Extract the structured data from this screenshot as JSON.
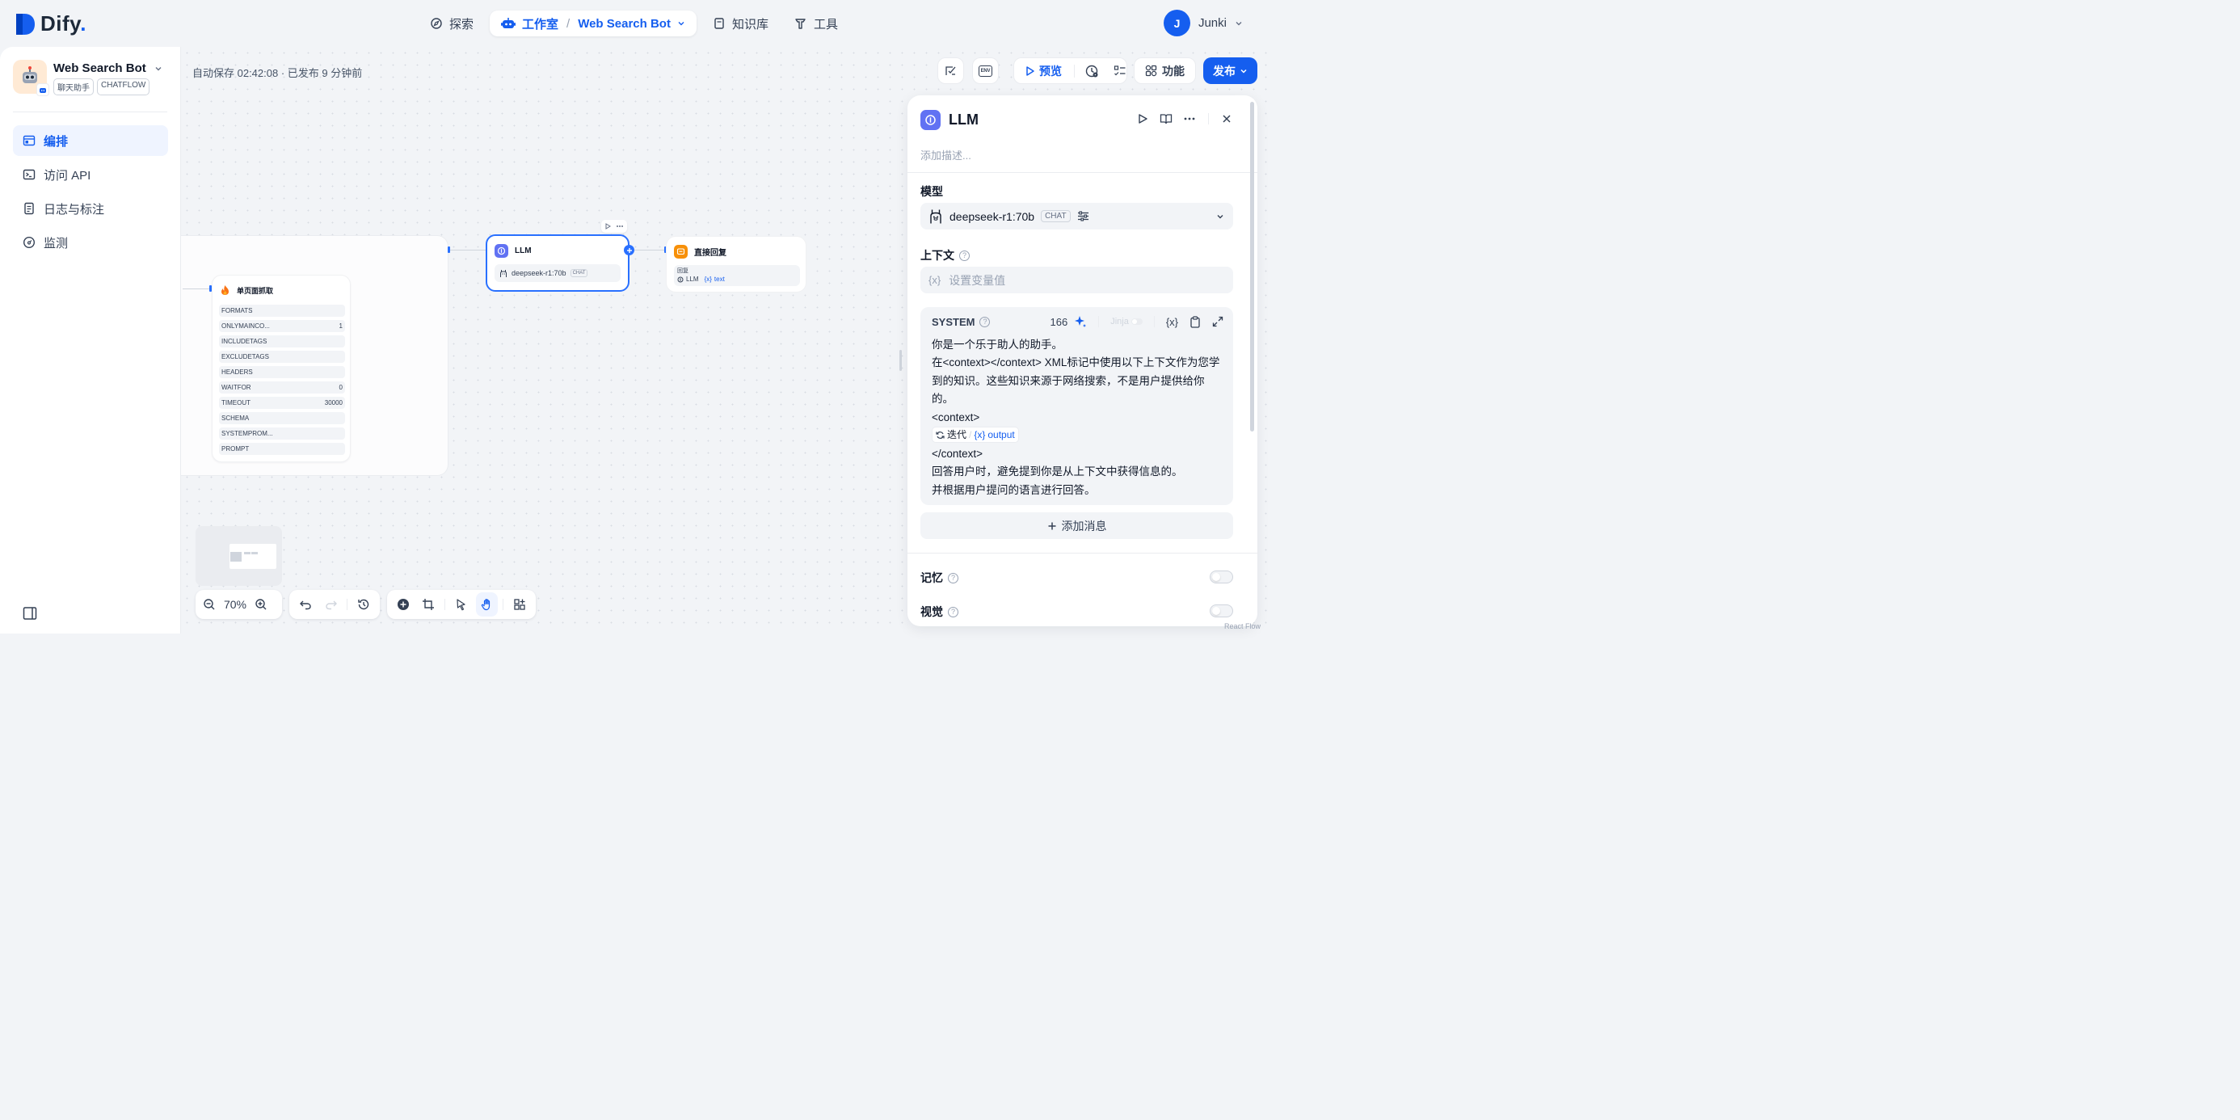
{
  "brand": {
    "logo_text": "Dify",
    "logo_suffix": "."
  },
  "nav": {
    "explore": "探索",
    "studio": "工作室",
    "separator": "/",
    "current_app": "Web Search Bot",
    "knowledge": "知识库",
    "tools": "工具"
  },
  "user": {
    "initial": "J",
    "name": "Junki"
  },
  "sidebar": {
    "app_name": "Web Search Bot",
    "app_tags": [
      "聊天助手",
      "CHATFLOW"
    ],
    "items": [
      {
        "label": "编排",
        "icon": "layout-icon",
        "active": true
      },
      {
        "label": "访问 API",
        "icon": "terminal-icon",
        "active": false
      },
      {
        "label": "日志与标注",
        "icon": "file-list-icon",
        "active": false
      },
      {
        "label": "监测",
        "icon": "dashboard-icon",
        "active": false
      }
    ]
  },
  "status": {
    "autosave": "自动保存 02:42:08 · 已发布 9 分钟前"
  },
  "header_actions": {
    "env": "ENV",
    "preview": "预览",
    "features": "功能",
    "publish": "发布"
  },
  "canvas": {
    "iteration_node": {
      "title": "单页面抓取",
      "params": [
        {
          "key": "FORMATS",
          "value": ""
        },
        {
          "key": "ONLYMAINCO...",
          "value": "1"
        },
        {
          "key": "INCLUDETAGS",
          "value": ""
        },
        {
          "key": "EXCLUDETAGS",
          "value": ""
        },
        {
          "key": "HEADERS",
          "value": ""
        },
        {
          "key": "WAITFOR",
          "value": "0"
        },
        {
          "key": "TIMEOUT",
          "value": "30000"
        },
        {
          "key": "SCHEMA",
          "value": ""
        },
        {
          "key": "SYSTEMPROM...",
          "value": ""
        },
        {
          "key": "PROMPT",
          "value": ""
        }
      ]
    },
    "llm_node": {
      "title": "LLM",
      "model": "deepseek-r1:70b",
      "model_tag": "CHAT"
    },
    "answer_node": {
      "title": "直接回复",
      "reply_label": "回复",
      "ref_node": "LLM",
      "ref_var": "text"
    },
    "zoom": "70%"
  },
  "panel": {
    "title": "LLM",
    "description_placeholder": "添加描述...",
    "model_label": "模型",
    "model_name": "deepseek-r1:70b",
    "model_tag": "CHAT",
    "context_label": "上下文",
    "context_placeholder": "设置变量值",
    "system": {
      "label": "SYSTEM",
      "count": "166",
      "jinja": "Jinja",
      "lines_before": [
        "你是一个乐于助人的助手。",
        "在<context></context> XML标记中使用以下上下文作为您学到的知识。这些知识来源于网络搜索，不是用户提供给你的。",
        "<context>"
      ],
      "chip_node": "迭代",
      "chip_var": "output",
      "lines_after": [
        "</context>",
        "回答用户时，避免提到你是从上下文中获得信息的。",
        "并根据用户提问的语言进行回答。"
      ]
    },
    "add_message": "添加消息",
    "memory_label": "记忆",
    "vision_label": "视觉"
  },
  "footer": {
    "attribution": "React Flow"
  }
}
